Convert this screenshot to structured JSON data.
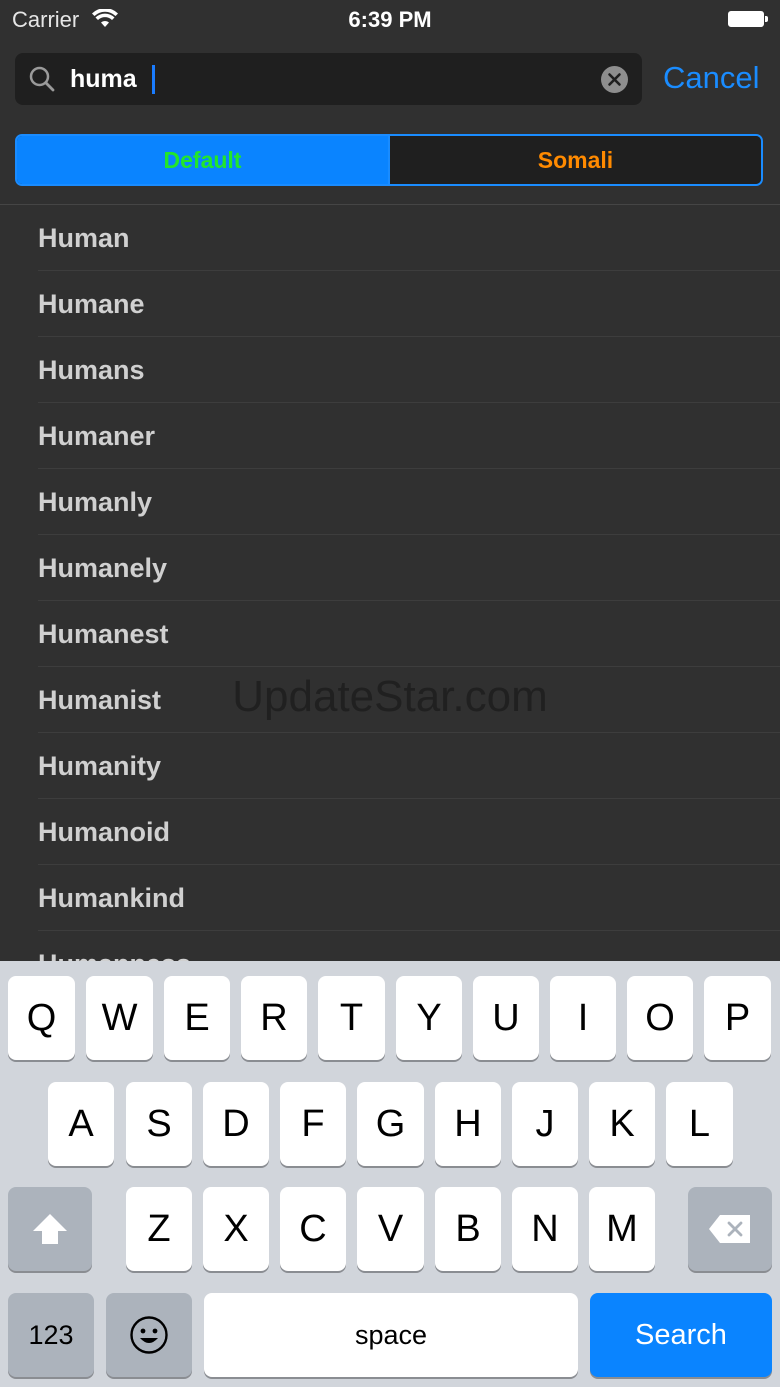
{
  "status_bar": {
    "carrier": "Carrier",
    "time": "6:39 PM"
  },
  "search": {
    "value": "huma",
    "cancel_label": "Cancel"
  },
  "segments": {
    "default_label": "Default",
    "somali_label": "Somali",
    "selected": "Default"
  },
  "results": [
    "Human",
    "Humane",
    "Humans",
    "Humaner",
    "Humanly",
    "Humanely",
    "Humanest",
    "Humanist",
    "Humanity",
    "Humanoid",
    "Humankind",
    "Humanness"
  ],
  "watermark": "UpdateStar.com",
  "keyboard": {
    "row1": [
      "Q",
      "W",
      "E",
      "R",
      "T",
      "Y",
      "U",
      "I",
      "O",
      "P"
    ],
    "row2": [
      "A",
      "S",
      "D",
      "F",
      "G",
      "H",
      "J",
      "K",
      "L"
    ],
    "row3": [
      "Z",
      "X",
      "C",
      "V",
      "B",
      "N",
      "M"
    ],
    "numbers_label": "123",
    "space_label": "space",
    "search_label": "Search"
  },
  "colors": {
    "accent": "#1a8cff",
    "default_segment_text": "#22e62a",
    "somali_segment_text": "#ff8a00",
    "background": "#303030"
  }
}
